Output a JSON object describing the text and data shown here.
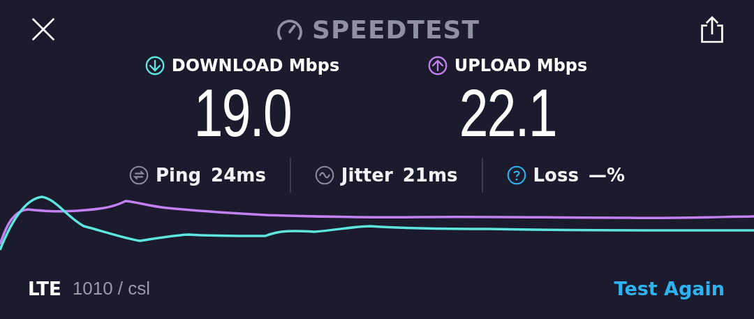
{
  "header": {
    "title": "SPEEDTEST"
  },
  "metrics": [
    {
      "kind": "download",
      "label": "DOWNLOAD Mbps",
      "value": "19.0",
      "color": "#5ce6de"
    },
    {
      "kind": "upload",
      "label": "UPLOAD Mbps",
      "value": "22.1",
      "color": "#c281f0"
    }
  ],
  "stats": [
    {
      "kind": "ping",
      "label": "Ping",
      "value": "24ms"
    },
    {
      "kind": "jitter",
      "label": "Jitter",
      "value": "21ms"
    },
    {
      "kind": "loss",
      "label": "Loss",
      "value": "—%"
    }
  ],
  "footer": {
    "network": "LTE",
    "carrier": "1010 / csl",
    "button": "Test Again"
  }
}
